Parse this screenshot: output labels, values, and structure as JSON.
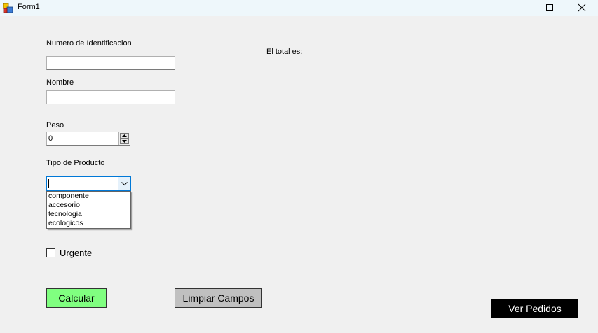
{
  "window": {
    "title": "Form1"
  },
  "form": {
    "id_label": "Numero de Identificacion",
    "id_value": "",
    "name_label": "Nombre",
    "name_value": "",
    "weight_label": "Peso",
    "weight_value": "0",
    "product_type_label": "Tipo de Producto",
    "product_type_value": "",
    "product_type_options": [
      "componente",
      "accesorio",
      "tecnologia",
      "ecologicos"
    ],
    "urgent_label": "Urgente",
    "urgent_checked": false,
    "total_label": "El total es:"
  },
  "buttons": {
    "calculate": "Calcular",
    "clear": "Limpiar Campos",
    "view_orders": "Ver Pedidos"
  },
  "colors": {
    "calculate_bg": "#80ff80",
    "clear_bg": "#c0c0c0",
    "view_orders_bg": "#000000",
    "view_orders_fg": "#ffffff",
    "combo_accent": "#0078d7"
  }
}
